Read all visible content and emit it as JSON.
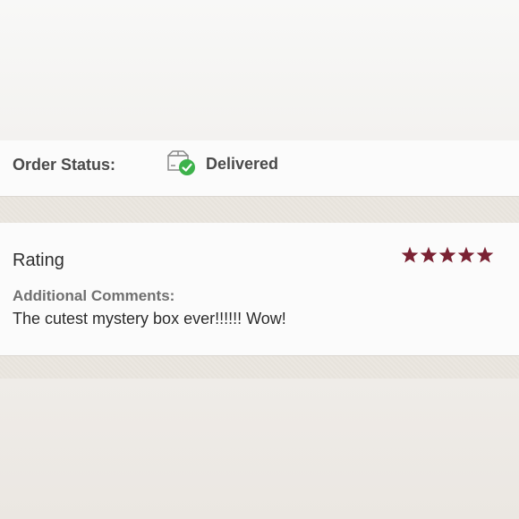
{
  "order_status": {
    "label": "Order Status:",
    "value": "Delivered",
    "icon": "box-delivered-check-icon",
    "check_color": "#3db24b"
  },
  "review": {
    "rating_label": "Rating",
    "rating": 5,
    "rating_max": 5,
    "star_color": "#7a2233",
    "comments_label": "Additional Comments:",
    "comment": "The cutest mystery box ever!!!!!! Wow!"
  }
}
